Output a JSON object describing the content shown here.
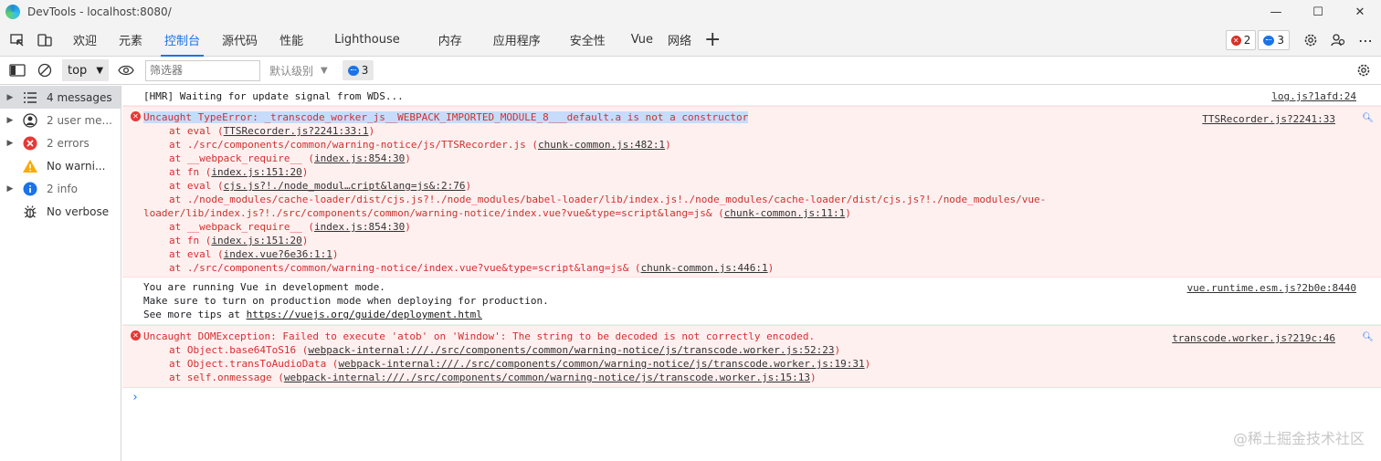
{
  "window": {
    "title": "DevTools - localhost:8080/",
    "minimize": "—",
    "maximize": "☐",
    "close": "✕"
  },
  "tabs": [
    {
      "label": "欢迎"
    },
    {
      "label": "元素"
    },
    {
      "label": "控制台"
    },
    {
      "label": "源代码"
    },
    {
      "label": "性能"
    },
    {
      "label": "Lighthouse"
    },
    {
      "label": "内存"
    },
    {
      "label": "应用程序"
    },
    {
      "label": "安全性"
    },
    {
      "label": "Vue"
    },
    {
      "label": "网络"
    }
  ],
  "toolbar": {
    "error_count": "2",
    "issue_count": "3"
  },
  "console_toolbar": {
    "context": "top",
    "filter_placeholder": "筛选器",
    "levels": "默认级别",
    "issues": "3"
  },
  "sidebar": {
    "items": [
      {
        "label": "4 messages"
      },
      {
        "label": "2 user me..."
      },
      {
        "label": "2 errors"
      },
      {
        "label": "No warni..."
      },
      {
        "label": "2 info"
      },
      {
        "label": "No verbose"
      }
    ]
  },
  "messages": {
    "m1": {
      "text": "[HMR] Waiting for update signal from WDS...",
      "source": "log.js?1afd:24"
    },
    "m2": {
      "source": "TTSRecorder.js?2241:33",
      "head": "Uncaught TypeError: _transcode_worker_js__WEBPACK_IMPORTED_MODULE_8___default.a is not a constructor",
      "l1a": "at eval (",
      "l1b": "TTSRecorder.js?2241:33:1",
      "l1c": ")",
      "l2a": "at ./src/components/common/warning-notice/js/TTSRecorder.js (",
      "l2b": "chunk-common.js:482:1",
      "l2c": ")",
      "l3a": "at __webpack_require__ (",
      "l3b": "index.js:854:30",
      "l3c": ")",
      "l4a": "at fn (",
      "l4b": "index.js:151:20",
      "l4c": ")",
      "l5a": "at eval (",
      "l5b": "cjs.js?!./node_modul…cript&lang=js&:2:76",
      "l5c": ")",
      "l6": "at ./node_modules/cache-loader/dist/cjs.js?!./node_modules/babel-loader/lib/index.js!./node_modules/cache-loader/dist/cjs.js?!./node_modules/vue-",
      "l7a": "loader/lib/index.js?!./src/components/common/warning-notice/index.vue?vue&type=script&lang=js& (",
      "l7b": "chunk-common.js:11:1",
      "l7c": ")",
      "l8a": "at __webpack_require__ (",
      "l8b": "index.js:854:30",
      "l8c": ")",
      "l9a": "at fn (",
      "l9b": "index.js:151:20",
      "l9c": ")",
      "l10a": "at eval (",
      "l10b": "index.vue?6e36:1:1",
      "l10c": ")",
      "l11a": "at ./src/components/common/warning-notice/index.vue?vue&type=script&lang=js& (",
      "l11b": "chunk-common.js:446:1",
      "l11c": ")"
    },
    "m3": {
      "source": "vue.runtime.esm.js?2b0e:8440",
      "l1": "You are running Vue in development mode.",
      "l2": "Make sure to turn on production mode when deploying for production.",
      "l3a": "See more tips at ",
      "l3b": "https://vuejs.org/guide/deployment.html"
    },
    "m4": {
      "source": "transcode.worker.js?219c:46",
      "head": "Uncaught DOMException: Failed to execute 'atob' on 'Window': The string to be decoded is not correctly encoded.",
      "l1a": "at Object.base64ToS16 (",
      "l1b": "webpack-internal:///./src/components/common/warning-notice/js/transcode.worker.js:52:23",
      "l1c": ")",
      "l2a": "at Object.transToAudioData (",
      "l2b": "webpack-internal:///./src/components/common/warning-notice/js/transcode.worker.js:19:31",
      "l2c": ")",
      "l3a": "at self.onmessage (",
      "l3b": "webpack-internal:///./src/components/common/warning-notice/js/transcode.worker.js:15:13",
      "l3c": ")"
    }
  },
  "prompt": "›",
  "watermark": "@稀土掘金技术社区",
  "colors": {
    "accent": "#1a73e8",
    "error": "#d32f2f",
    "error_bg": "#fff0f0"
  }
}
